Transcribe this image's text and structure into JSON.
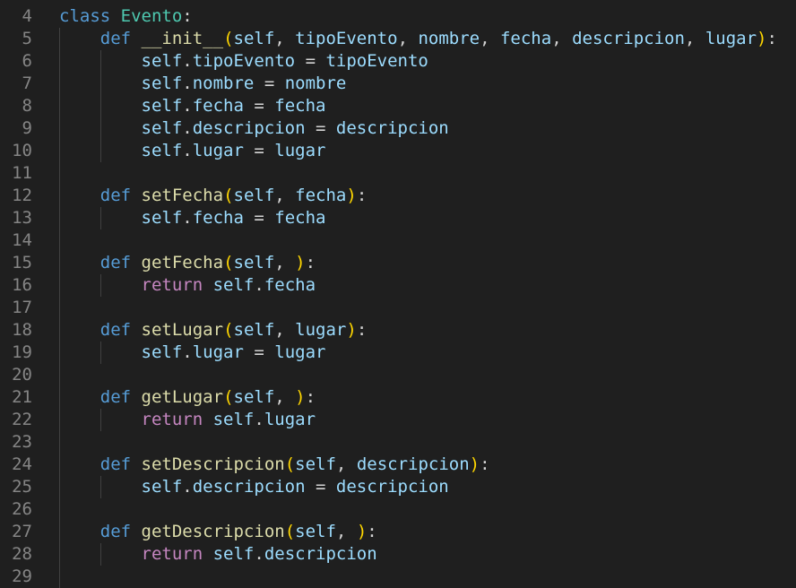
{
  "editor": {
    "colors": {
      "background": "#1f1f1f",
      "line_number": "#858585",
      "keyword": "#569cd6",
      "class_name": "#4ec9b0",
      "function": "#dcdcaa",
      "variable": "#9cdcfe",
      "control": "#c586c0",
      "bracket": "#ffd700",
      "text": "#d4d4d4"
    },
    "lines": [
      {
        "n": "4",
        "tokens": [
          [
            "kw",
            "class"
          ],
          [
            "plain",
            " "
          ],
          [
            "cls",
            "Evento"
          ],
          [
            "plain",
            ":"
          ]
        ]
      },
      {
        "n": "5",
        "tokens": [
          [
            "plain",
            "    "
          ],
          [
            "kw",
            "def"
          ],
          [
            "plain",
            " "
          ],
          [
            "fn",
            "__init__"
          ],
          [
            "br",
            "("
          ],
          [
            "self",
            "self"
          ],
          [
            "plain",
            ", "
          ],
          [
            "param",
            "tipoEvento"
          ],
          [
            "plain",
            ", "
          ],
          [
            "param",
            "nombre"
          ],
          [
            "plain",
            ", "
          ],
          [
            "param",
            "fecha"
          ],
          [
            "plain",
            ", "
          ],
          [
            "param",
            "descripcion"
          ],
          [
            "plain",
            ", "
          ],
          [
            "param",
            "lugar"
          ],
          [
            "br",
            ")"
          ],
          [
            "plain",
            ":"
          ]
        ]
      },
      {
        "n": "6",
        "tokens": [
          [
            "plain",
            "        "
          ],
          [
            "self",
            "self"
          ],
          [
            "plain",
            "."
          ],
          [
            "param",
            "tipoEvento"
          ],
          [
            "plain",
            " = "
          ],
          [
            "param",
            "tipoEvento"
          ]
        ]
      },
      {
        "n": "7",
        "tokens": [
          [
            "plain",
            "        "
          ],
          [
            "self",
            "self"
          ],
          [
            "plain",
            "."
          ],
          [
            "param",
            "nombre"
          ],
          [
            "plain",
            " = "
          ],
          [
            "param",
            "nombre"
          ]
        ]
      },
      {
        "n": "8",
        "tokens": [
          [
            "plain",
            "        "
          ],
          [
            "self",
            "self"
          ],
          [
            "plain",
            "."
          ],
          [
            "param",
            "fecha"
          ],
          [
            "plain",
            " = "
          ],
          [
            "param",
            "fecha"
          ]
        ]
      },
      {
        "n": "9",
        "tokens": [
          [
            "plain",
            "        "
          ],
          [
            "self",
            "self"
          ],
          [
            "plain",
            "."
          ],
          [
            "param",
            "descripcion"
          ],
          [
            "plain",
            " = "
          ],
          [
            "param",
            "descripcion"
          ]
        ]
      },
      {
        "n": "10",
        "tokens": [
          [
            "plain",
            "        "
          ],
          [
            "self",
            "self"
          ],
          [
            "plain",
            "."
          ],
          [
            "param",
            "lugar"
          ],
          [
            "plain",
            " = "
          ],
          [
            "param",
            "lugar"
          ]
        ]
      },
      {
        "n": "11",
        "tokens": []
      },
      {
        "n": "12",
        "tokens": [
          [
            "plain",
            "    "
          ],
          [
            "kw",
            "def"
          ],
          [
            "plain",
            " "
          ],
          [
            "fn",
            "setFecha"
          ],
          [
            "br",
            "("
          ],
          [
            "self",
            "self"
          ],
          [
            "plain",
            ", "
          ],
          [
            "param",
            "fecha"
          ],
          [
            "br",
            ")"
          ],
          [
            "plain",
            ":"
          ]
        ]
      },
      {
        "n": "13",
        "tokens": [
          [
            "plain",
            "        "
          ],
          [
            "self",
            "self"
          ],
          [
            "plain",
            "."
          ],
          [
            "param",
            "fecha"
          ],
          [
            "plain",
            " = "
          ],
          [
            "param",
            "fecha"
          ]
        ]
      },
      {
        "n": "14",
        "tokens": []
      },
      {
        "n": "15",
        "tokens": [
          [
            "plain",
            "    "
          ],
          [
            "kw",
            "def"
          ],
          [
            "plain",
            " "
          ],
          [
            "fn",
            "getFecha"
          ],
          [
            "br",
            "("
          ],
          [
            "self",
            "self"
          ],
          [
            "plain",
            ", "
          ],
          [
            "br",
            ")"
          ],
          [
            "plain",
            ":"
          ]
        ]
      },
      {
        "n": "16",
        "tokens": [
          [
            "plain",
            "        "
          ],
          [
            "ctrl",
            "return"
          ],
          [
            "plain",
            " "
          ],
          [
            "self",
            "self"
          ],
          [
            "plain",
            "."
          ],
          [
            "param",
            "fecha"
          ]
        ]
      },
      {
        "n": "17",
        "tokens": []
      },
      {
        "n": "18",
        "tokens": [
          [
            "plain",
            "    "
          ],
          [
            "kw",
            "def"
          ],
          [
            "plain",
            " "
          ],
          [
            "fn",
            "setLugar"
          ],
          [
            "br",
            "("
          ],
          [
            "self",
            "self"
          ],
          [
            "plain",
            ", "
          ],
          [
            "param",
            "lugar"
          ],
          [
            "br",
            ")"
          ],
          [
            "plain",
            ":"
          ]
        ]
      },
      {
        "n": "19",
        "tokens": [
          [
            "plain",
            "        "
          ],
          [
            "self",
            "self"
          ],
          [
            "plain",
            "."
          ],
          [
            "param",
            "lugar"
          ],
          [
            "plain",
            " = "
          ],
          [
            "param",
            "lugar"
          ]
        ]
      },
      {
        "n": "20",
        "tokens": []
      },
      {
        "n": "21",
        "tokens": [
          [
            "plain",
            "    "
          ],
          [
            "kw",
            "def"
          ],
          [
            "plain",
            " "
          ],
          [
            "fn",
            "getLugar"
          ],
          [
            "br",
            "("
          ],
          [
            "self",
            "self"
          ],
          [
            "plain",
            ", "
          ],
          [
            "br",
            ")"
          ],
          [
            "plain",
            ":"
          ]
        ]
      },
      {
        "n": "22",
        "tokens": [
          [
            "plain",
            "        "
          ],
          [
            "ctrl",
            "return"
          ],
          [
            "plain",
            " "
          ],
          [
            "self",
            "self"
          ],
          [
            "plain",
            "."
          ],
          [
            "param",
            "lugar"
          ]
        ]
      },
      {
        "n": "23",
        "tokens": []
      },
      {
        "n": "24",
        "tokens": [
          [
            "plain",
            "    "
          ],
          [
            "kw",
            "def"
          ],
          [
            "plain",
            " "
          ],
          [
            "fn",
            "setDescripcion"
          ],
          [
            "br",
            "("
          ],
          [
            "self",
            "self"
          ],
          [
            "plain",
            ", "
          ],
          [
            "param",
            "descripcion"
          ],
          [
            "br",
            ")"
          ],
          [
            "plain",
            ":"
          ]
        ]
      },
      {
        "n": "25",
        "tokens": [
          [
            "plain",
            "        "
          ],
          [
            "self",
            "self"
          ],
          [
            "plain",
            "."
          ],
          [
            "param",
            "descripcion"
          ],
          [
            "plain",
            " = "
          ],
          [
            "param",
            "descripcion"
          ]
        ]
      },
      {
        "n": "26",
        "tokens": []
      },
      {
        "n": "27",
        "tokens": [
          [
            "plain",
            "    "
          ],
          [
            "kw",
            "def"
          ],
          [
            "plain",
            " "
          ],
          [
            "fn",
            "getDescripcion"
          ],
          [
            "br",
            "("
          ],
          [
            "self",
            "self"
          ],
          [
            "plain",
            ", "
          ],
          [
            "br",
            ")"
          ],
          [
            "plain",
            ":"
          ]
        ]
      },
      {
        "n": "28",
        "tokens": [
          [
            "plain",
            "        "
          ],
          [
            "ctrl",
            "return"
          ],
          [
            "plain",
            " "
          ],
          [
            "self",
            "self"
          ],
          [
            "plain",
            "."
          ],
          [
            "param",
            "descripcion"
          ]
        ]
      },
      {
        "n": "29",
        "tokens": []
      }
    ]
  }
}
